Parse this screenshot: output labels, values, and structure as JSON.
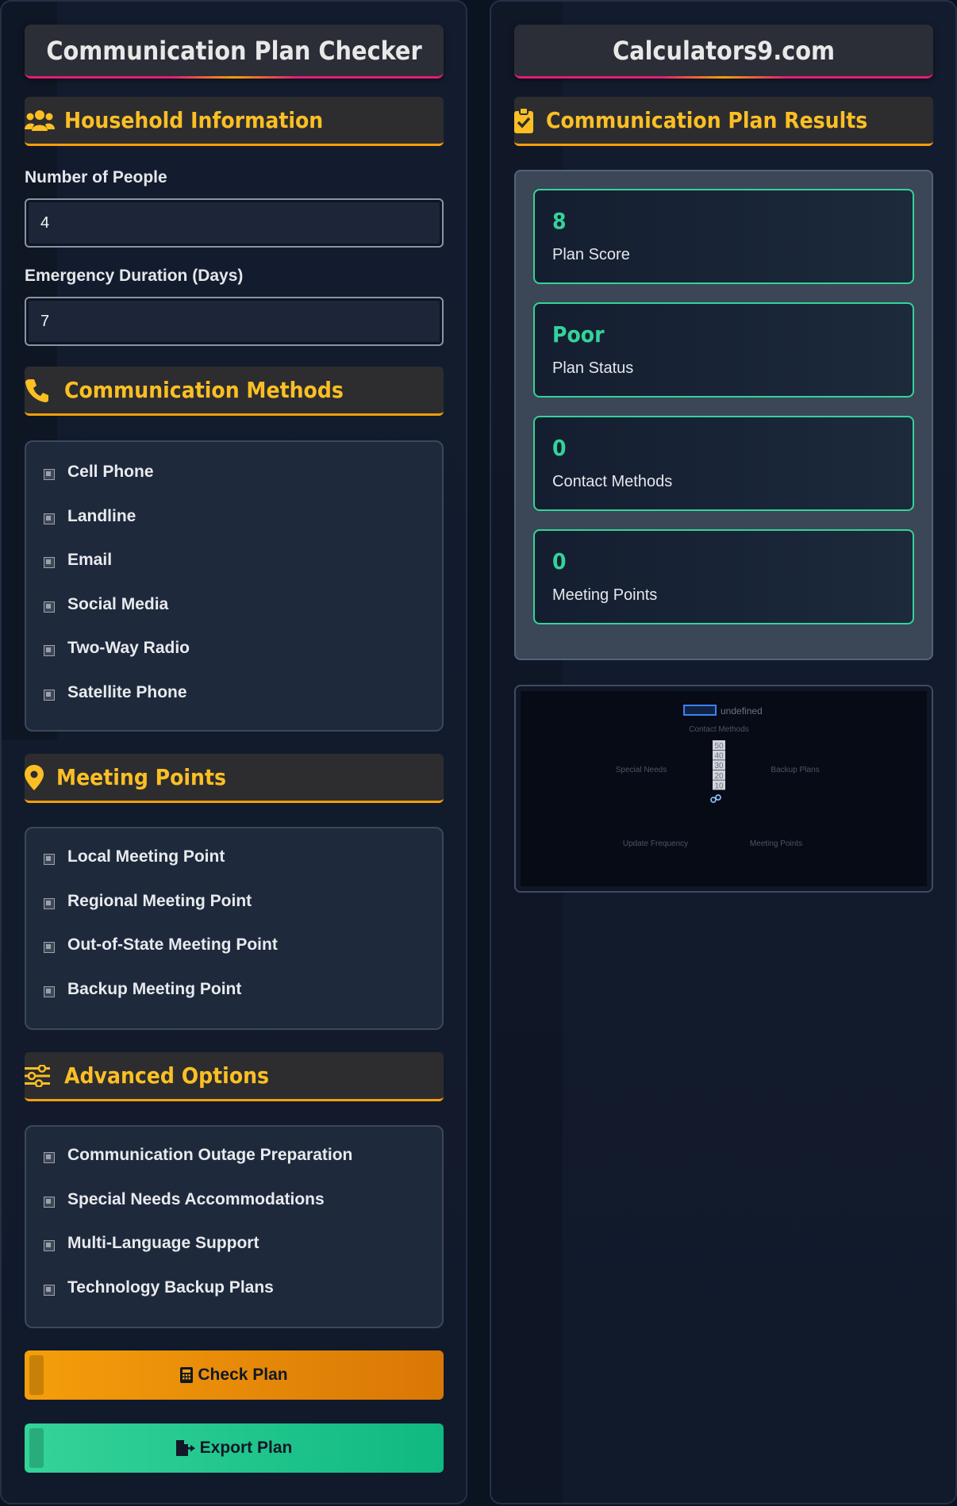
{
  "left_panel": {
    "title": "Communication Plan Checker",
    "household": {
      "heading": "Household Information",
      "icon": "users-icon",
      "people_label": "Number of People",
      "people_value": "4",
      "duration_label": "Emergency Duration (Days)",
      "duration_value": "7"
    },
    "methods": {
      "heading": "Communication Methods",
      "icon": "phone-icon",
      "items": [
        "Cell Phone",
        "Landline",
        "Email",
        "Social Media",
        "Two-Way Radio",
        "Satellite Phone"
      ]
    },
    "meeting": {
      "heading": "Meeting Points",
      "icon": "map-pin-icon",
      "items": [
        "Local Meeting Point",
        "Regional Meeting Point",
        "Out-of-State Meeting Point",
        "Backup Meeting Point"
      ]
    },
    "advanced": {
      "heading": "Advanced Options",
      "icon": "sliders-icon",
      "items": [
        "Communication Outage Preparation",
        "Special Needs Accommodations",
        "Multi-Language Support",
        "Technology Backup Plans"
      ]
    },
    "check_button": "Check Plan",
    "export_button": "Export Plan"
  },
  "right_panel": {
    "title": "Calculators9.com",
    "results": {
      "heading": "Communication Plan Results",
      "icon": "clipboard-check-icon",
      "cards": [
        {
          "value": "8",
          "label": "Plan Score"
        },
        {
          "value": "Poor",
          "label": "Plan Status"
        },
        {
          "value": "0",
          "label": "Contact Methods"
        },
        {
          "value": "0",
          "label": "Meeting Points"
        }
      ]
    }
  },
  "chart_data": {
    "type": "radar",
    "legend": "undefined",
    "axes": [
      "Contact Methods",
      "Backup Plans",
      "Meeting Points",
      "Update Frequency",
      "Special Needs"
    ],
    "ticks": [
      "50",
      "40",
      "30",
      "20",
      "10"
    ],
    "values": [
      0,
      0,
      0,
      0,
      0
    ],
    "rlim": [
      0,
      50
    ]
  },
  "colors": {
    "accent_yellow": "#fbbf24",
    "accent_green": "#34d399",
    "accent_orange": "#f59e0b",
    "title_underline": "#e11d74"
  }
}
